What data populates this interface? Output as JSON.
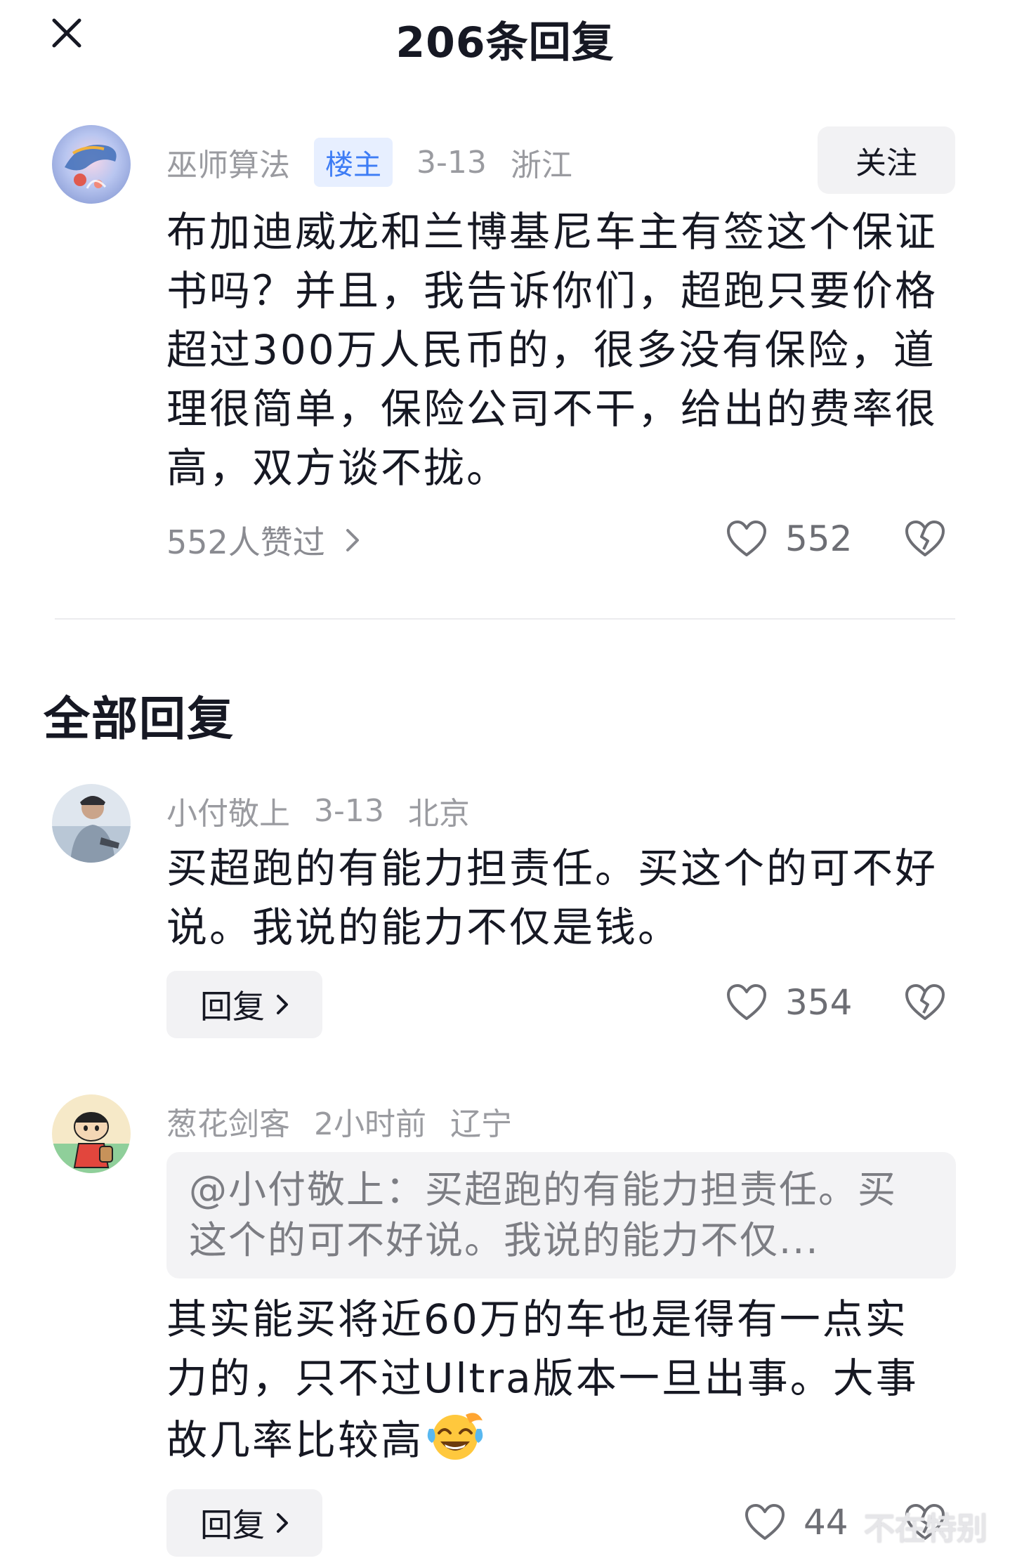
{
  "header": {
    "title": "206条回复"
  },
  "main_comment": {
    "username": "巫师算法",
    "badge": "楼主",
    "date": "3-13",
    "location": "浙江",
    "follow_label": "关注",
    "text": "布加迪威龙和兰博基尼车主有签这个保证书吗？并且，我告诉你们，超跑只要价格超过300万人民币的，很多没有保险，道理很简单，保险公司不干，给出的费率很高，双方谈不拢。",
    "likers_label": "552人赞过",
    "like_count": "552"
  },
  "section_title": "全部回复",
  "replies": [
    {
      "username": "小付敬上",
      "date": "3-13",
      "location": "北京",
      "text": "买超跑的有能力担责任。买这个的可不好说。我说的能力不仅是钱。",
      "reply_label": "回复",
      "like_count": "354"
    },
    {
      "username": "葱花剑客",
      "date": "2小时前",
      "location": "辽宁",
      "quote": "@小付敬上：买超跑的有能力担责任。买这个的可不好说。我说的能力不仅...",
      "text": "其实能买将近60万的车也是得有一点实力的，只不过Ultra版本一旦出事。大事故几率比较高",
      "reply_label": "回复",
      "like_count": "44"
    }
  ],
  "watermark": "不在特别",
  "colors": {
    "accent": "#3d7cf5",
    "muted": "#9a9ba0",
    "text": "#161823"
  }
}
